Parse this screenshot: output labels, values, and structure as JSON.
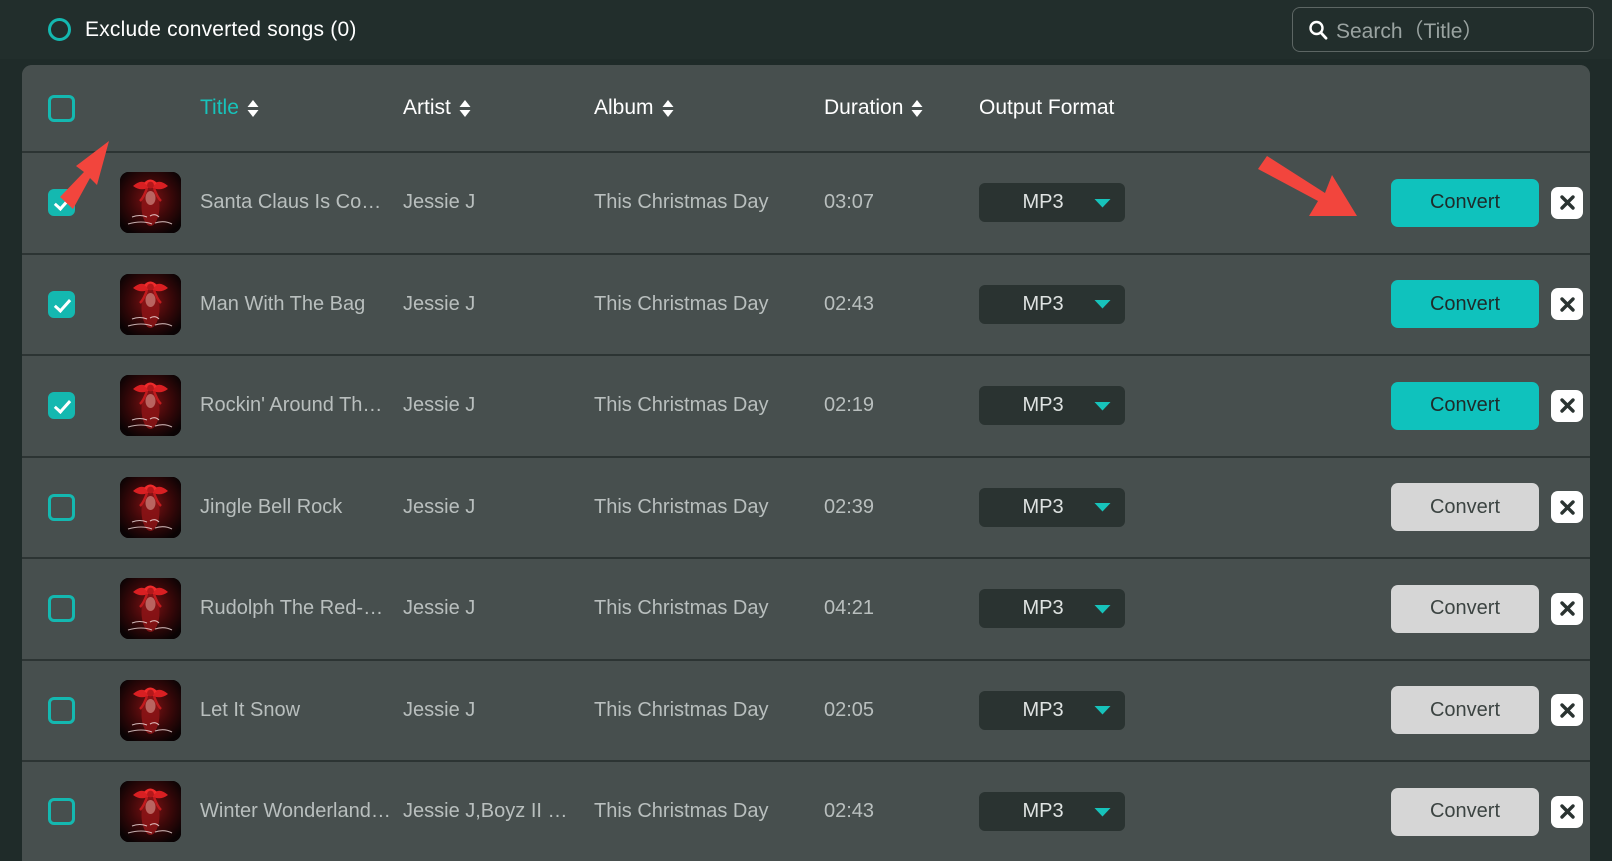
{
  "topbar": {
    "exclude_label": "Exclude converted songs (0)",
    "exclude_icon": "radio-circle-icon",
    "search_icon": "search-icon",
    "search_placeholder": "Search（Title）",
    "search_value": ""
  },
  "table": {
    "select_all_checked": false,
    "columns": [
      {
        "key": "title",
        "label": "Title",
        "sortable": true,
        "active": true
      },
      {
        "key": "artist",
        "label": "Artist",
        "sortable": true,
        "active": false
      },
      {
        "key": "album",
        "label": "Album",
        "sortable": true,
        "active": false
      },
      {
        "key": "dur",
        "label": "Duration",
        "sortable": true,
        "active": false
      },
      {
        "key": "fmt",
        "label": "Output Format",
        "sortable": false,
        "active": false
      }
    ],
    "sort_icon": "sort-updown-icon",
    "caret_icon": "chevron-down-icon",
    "delete_icon": "close-x-icon",
    "rows": [
      {
        "checked": true,
        "title": "Santa Claus Is Co…",
        "artist": "Jessie J",
        "album": "This Christmas Day",
        "duration": "03:07",
        "format": "MP3",
        "convert_label": "Convert",
        "convert_active": true
      },
      {
        "checked": true,
        "title": "Man With The Bag",
        "artist": "Jessie J",
        "album": "This Christmas Day",
        "duration": "02:43",
        "format": "MP3",
        "convert_label": "Convert",
        "convert_active": true
      },
      {
        "checked": true,
        "title": "Rockin' Around Th…",
        "artist": "Jessie J",
        "album": "This Christmas Day",
        "duration": "02:19",
        "format": "MP3",
        "convert_label": "Convert",
        "convert_active": true
      },
      {
        "checked": false,
        "title": "Jingle Bell Rock",
        "artist": "Jessie J",
        "album": "This Christmas Day",
        "duration": "02:39",
        "format": "MP3",
        "convert_label": "Convert",
        "convert_active": false
      },
      {
        "checked": false,
        "title": "Rudolph The Red-…",
        "artist": "Jessie J",
        "album": "This Christmas Day",
        "duration": "04:21",
        "format": "MP3",
        "convert_label": "Convert",
        "convert_active": false
      },
      {
        "checked": false,
        "title": "Let It Snow",
        "artist": "Jessie J",
        "album": "This Christmas Day",
        "duration": "02:05",
        "format": "MP3",
        "convert_label": "Convert",
        "convert_active": false
      },
      {
        "checked": false,
        "title": "Winter Wonderland…",
        "artist": "Jessie J,Boyz II …",
        "album": "This Christmas Day",
        "duration": "02:43",
        "format": "MP3",
        "convert_label": "Convert",
        "convert_active": false
      }
    ]
  },
  "annotations": {
    "arrow_color": "#f2453d",
    "arrow_to_checkbox": "arrow-pointing-to-row-checkbox",
    "arrow_to_convert": "arrow-pointing-to-convert-button"
  },
  "colors": {
    "accent": "#14b8b0",
    "convert_active": "#0fc2bd",
    "convert_idle": "#d6d6d6",
    "topbar_bg": "#222e2c",
    "table_bg": "#474f4e",
    "row_divider": "#2c3433",
    "page_bg": "#1f2b29",
    "text_primary": "#ffffff",
    "text_secondary": "#b9bfbe"
  }
}
